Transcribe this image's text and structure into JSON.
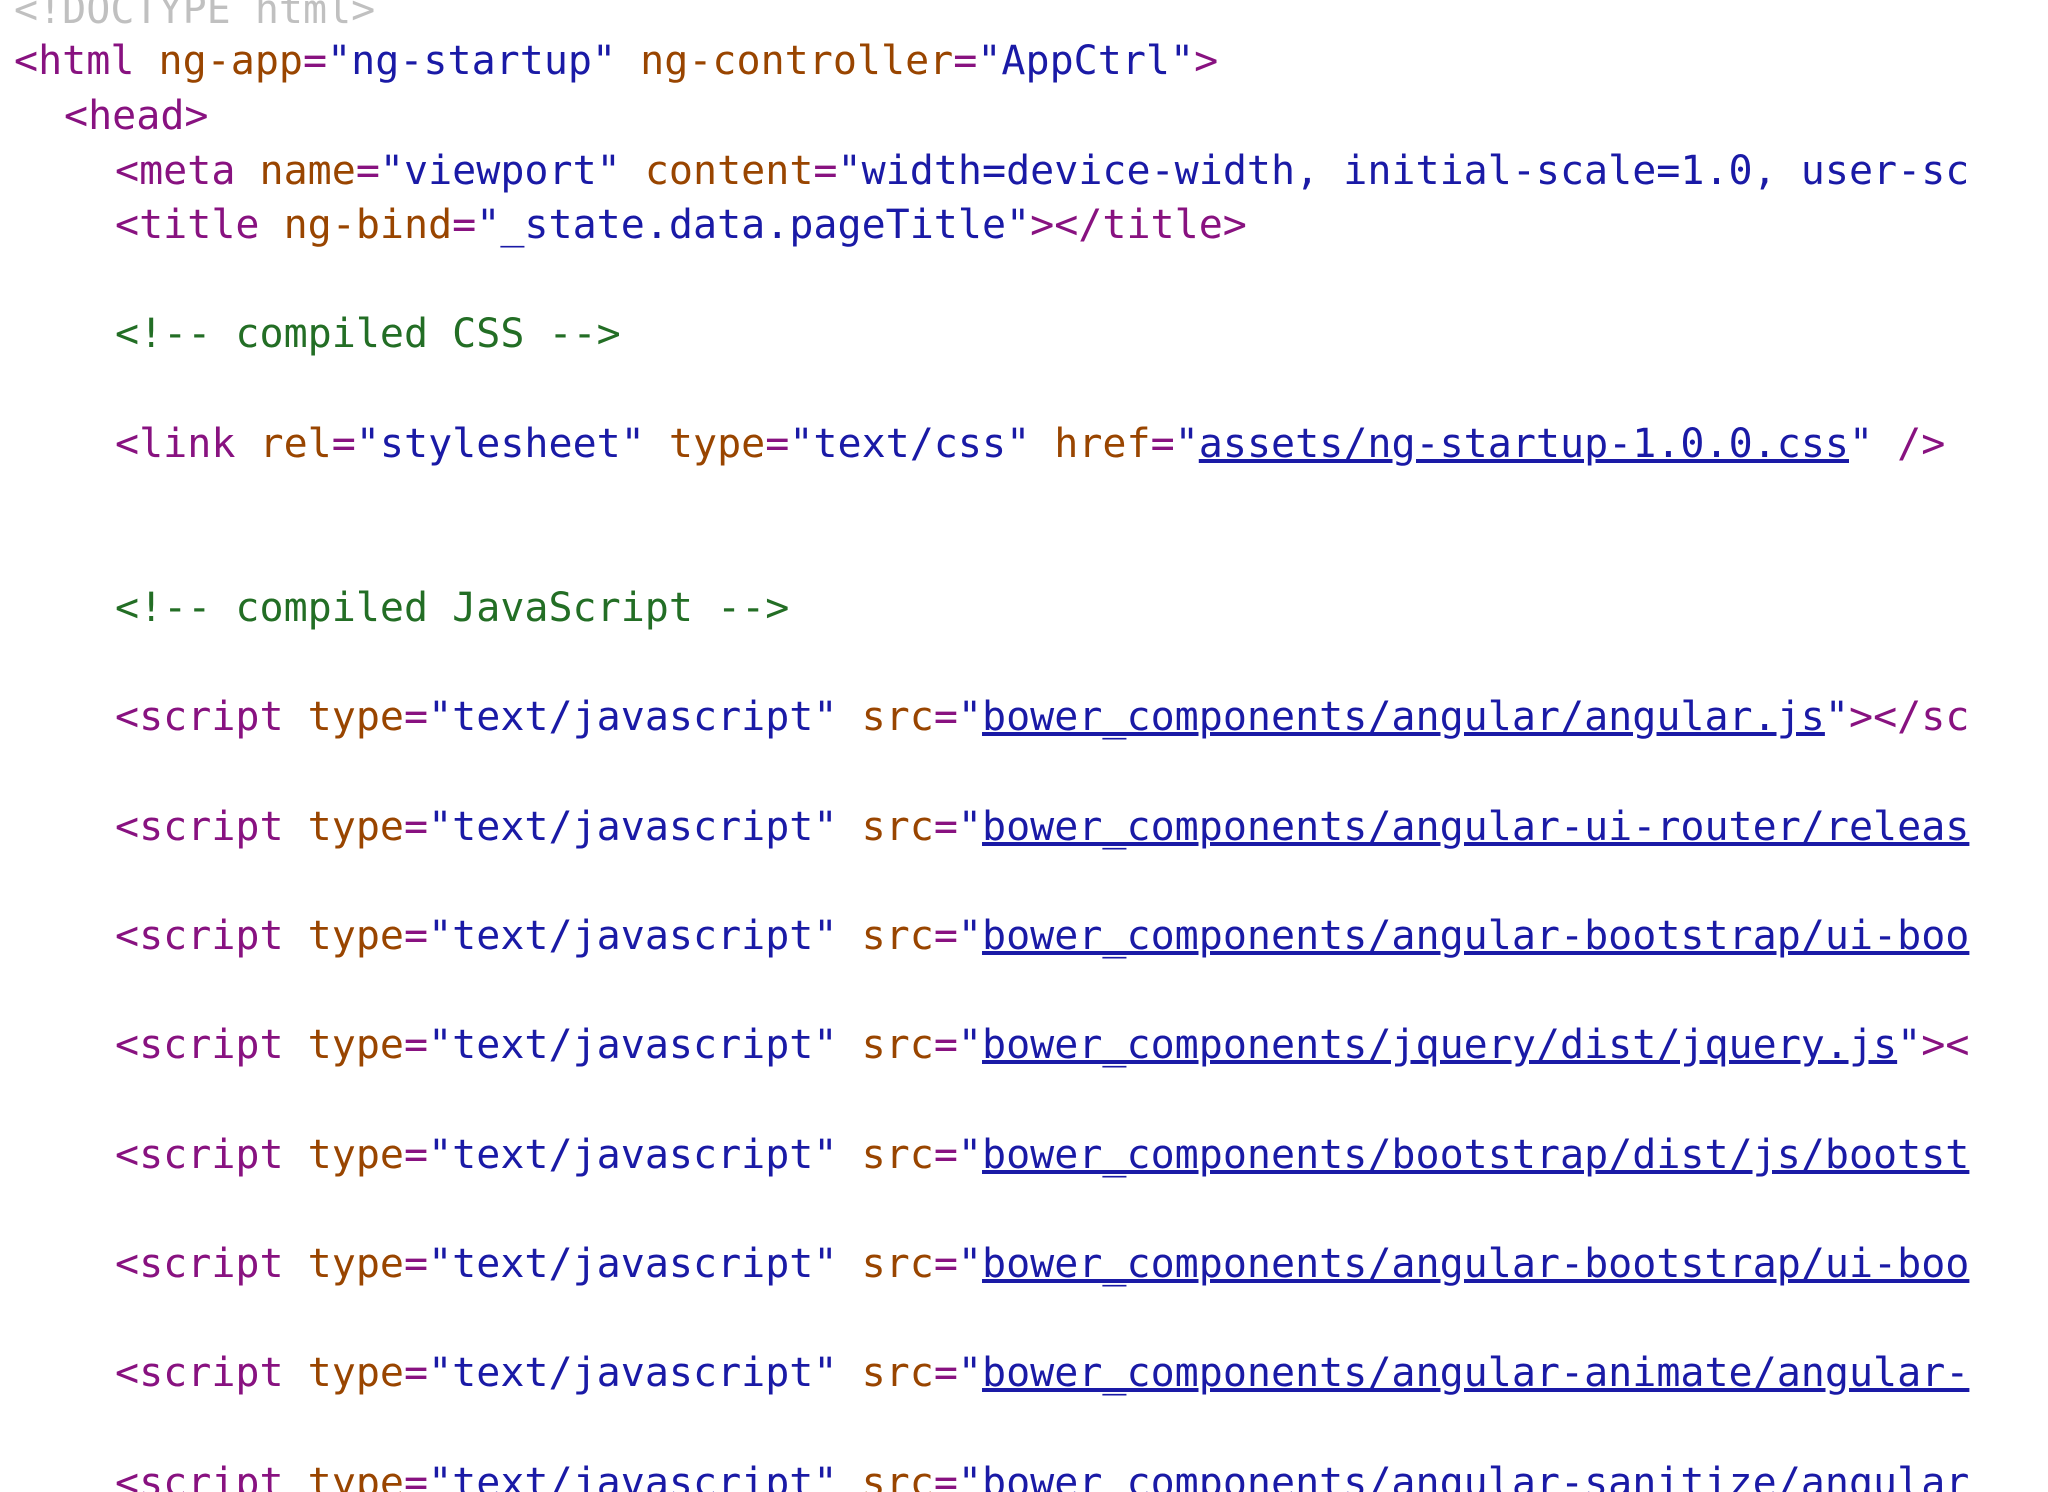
{
  "lines": [
    {
      "segments": [
        {
          "k": "doctype",
          "t": "<!DOCTYPE html>"
        }
      ]
    },
    {
      "segments": [
        {
          "k": "tag",
          "t": "<html "
        },
        {
          "k": "attr",
          "t": "ng-app"
        },
        {
          "k": "tag",
          "t": "="
        },
        {
          "k": "val",
          "t": "\"ng-startup\""
        },
        {
          "k": "tag",
          "t": " "
        },
        {
          "k": "attr",
          "t": "ng-controller"
        },
        {
          "k": "tag",
          "t": "="
        },
        {
          "k": "val",
          "t": "\"AppCtrl\""
        },
        {
          "k": "tag",
          "t": ">"
        }
      ]
    },
    {
      "segments": [
        {
          "k": "tag",
          "t": "<head>"
        }
      ]
    },
    {
      "segments": [
        {
          "k": "tag",
          "t": "<meta "
        },
        {
          "k": "attr",
          "t": "name"
        },
        {
          "k": "tag",
          "t": "="
        },
        {
          "k": "val",
          "t": "\"viewport\""
        },
        {
          "k": "tag",
          "t": " "
        },
        {
          "k": "attr",
          "t": "content"
        },
        {
          "k": "tag",
          "t": "="
        },
        {
          "k": "val",
          "t": "\"width=device-width, initial-scale=1.0, user-sc"
        }
      ]
    },
    {
      "segments": [
        {
          "k": "tag",
          "t": "<title "
        },
        {
          "k": "attr",
          "t": "ng-bind"
        },
        {
          "k": "tag",
          "t": "="
        },
        {
          "k": "val",
          "t": "\"_state.data.pageTitle\""
        },
        {
          "k": "tag",
          "t": "></title>"
        }
      ]
    },
    {
      "segments": [
        {
          "k": "comment",
          "t": "<!-- compiled CSS -->"
        }
      ]
    },
    {
      "segments": [
        {
          "k": "tag",
          "t": "<link "
        },
        {
          "k": "attr",
          "t": "rel"
        },
        {
          "k": "tag",
          "t": "="
        },
        {
          "k": "val",
          "t": "\"stylesheet\""
        },
        {
          "k": "tag",
          "t": " "
        },
        {
          "k": "attr",
          "t": "type"
        },
        {
          "k": "tag",
          "t": "="
        },
        {
          "k": "val",
          "t": "\"text/css\""
        },
        {
          "k": "tag",
          "t": " "
        },
        {
          "k": "attr",
          "t": "href"
        },
        {
          "k": "tag",
          "t": "="
        },
        {
          "k": "val",
          "t": "\""
        },
        {
          "k": "link",
          "t": "assets/ng-startup-1.0.0.css"
        },
        {
          "k": "val",
          "t": "\""
        },
        {
          "k": "tag",
          "t": " />"
        }
      ]
    },
    {
      "segments": [
        {
          "k": "comment",
          "t": "<!-- compiled JavaScript -->"
        }
      ]
    },
    {
      "segments": [
        {
          "k": "tag",
          "t": "<script "
        },
        {
          "k": "attr",
          "t": "type"
        },
        {
          "k": "tag",
          "t": "="
        },
        {
          "k": "val",
          "t": "\"text/javascript\""
        },
        {
          "k": "tag",
          "t": " "
        },
        {
          "k": "attr",
          "t": "src"
        },
        {
          "k": "tag",
          "t": "="
        },
        {
          "k": "val",
          "t": "\""
        },
        {
          "k": "link",
          "t": "bower_components/angular/angular.js"
        },
        {
          "k": "val",
          "t": "\""
        },
        {
          "k": "tag",
          "t": "></sc"
        }
      ]
    },
    {
      "segments": [
        {
          "k": "tag",
          "t": "<script "
        },
        {
          "k": "attr",
          "t": "type"
        },
        {
          "k": "tag",
          "t": "="
        },
        {
          "k": "val",
          "t": "\"text/javascript\""
        },
        {
          "k": "tag",
          "t": " "
        },
        {
          "k": "attr",
          "t": "src"
        },
        {
          "k": "tag",
          "t": "="
        },
        {
          "k": "val",
          "t": "\""
        },
        {
          "k": "link",
          "t": "bower_components/angular-ui-router/releas"
        }
      ]
    },
    {
      "segments": [
        {
          "k": "tag",
          "t": "<script "
        },
        {
          "k": "attr",
          "t": "type"
        },
        {
          "k": "tag",
          "t": "="
        },
        {
          "k": "val",
          "t": "\"text/javascript\""
        },
        {
          "k": "tag",
          "t": " "
        },
        {
          "k": "attr",
          "t": "src"
        },
        {
          "k": "tag",
          "t": "="
        },
        {
          "k": "val",
          "t": "\""
        },
        {
          "k": "link",
          "t": "bower_components/angular-bootstrap/ui-boo"
        }
      ]
    },
    {
      "segments": [
        {
          "k": "tag",
          "t": "<script "
        },
        {
          "k": "attr",
          "t": "type"
        },
        {
          "k": "tag",
          "t": "="
        },
        {
          "k": "val",
          "t": "\"text/javascript\""
        },
        {
          "k": "tag",
          "t": " "
        },
        {
          "k": "attr",
          "t": "src"
        },
        {
          "k": "tag",
          "t": "="
        },
        {
          "k": "val",
          "t": "\""
        },
        {
          "k": "link",
          "t": "bower_components/jquery/dist/jquery.js"
        },
        {
          "k": "val",
          "t": "\""
        },
        {
          "k": "tag",
          "t": "><"
        }
      ]
    },
    {
      "segments": [
        {
          "k": "tag",
          "t": "<script "
        },
        {
          "k": "attr",
          "t": "type"
        },
        {
          "k": "tag",
          "t": "="
        },
        {
          "k": "val",
          "t": "\"text/javascript\""
        },
        {
          "k": "tag",
          "t": " "
        },
        {
          "k": "attr",
          "t": "src"
        },
        {
          "k": "tag",
          "t": "="
        },
        {
          "k": "val",
          "t": "\""
        },
        {
          "k": "link",
          "t": "bower_components/bootstrap/dist/js/bootst"
        }
      ]
    },
    {
      "segments": [
        {
          "k": "tag",
          "t": "<script "
        },
        {
          "k": "attr",
          "t": "type"
        },
        {
          "k": "tag",
          "t": "="
        },
        {
          "k": "val",
          "t": "\"text/javascript\""
        },
        {
          "k": "tag",
          "t": " "
        },
        {
          "k": "attr",
          "t": "src"
        },
        {
          "k": "tag",
          "t": "="
        },
        {
          "k": "val",
          "t": "\""
        },
        {
          "k": "link",
          "t": "bower_components/angular-bootstrap/ui-boo"
        }
      ]
    },
    {
      "segments": [
        {
          "k": "tag",
          "t": "<script "
        },
        {
          "k": "attr",
          "t": "type"
        },
        {
          "k": "tag",
          "t": "="
        },
        {
          "k": "val",
          "t": "\"text/javascript\""
        },
        {
          "k": "tag",
          "t": " "
        },
        {
          "k": "attr",
          "t": "src"
        },
        {
          "k": "tag",
          "t": "="
        },
        {
          "k": "val",
          "t": "\""
        },
        {
          "k": "link",
          "t": "bower_components/angular-animate/angular-"
        }
      ]
    },
    {
      "segments": [
        {
          "k": "tag",
          "t": "<script "
        },
        {
          "k": "attr",
          "t": "type"
        },
        {
          "k": "tag",
          "t": "="
        },
        {
          "k": "val",
          "t": "\"text/javascript\""
        },
        {
          "k": "tag",
          "t": " "
        },
        {
          "k": "attr",
          "t": "src"
        },
        {
          "k": "tag",
          "t": "="
        },
        {
          "k": "val",
          "t": "\""
        },
        {
          "k": "link",
          "t": "bower_components/angular-sanitize/angular"
        }
      ]
    }
  ]
}
